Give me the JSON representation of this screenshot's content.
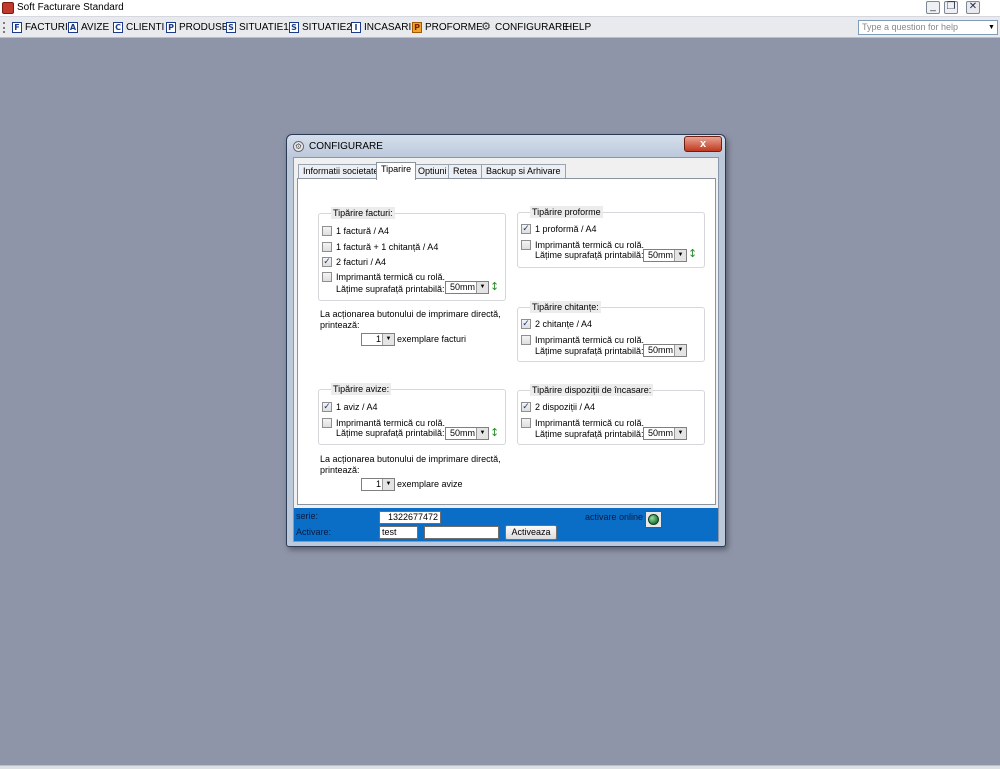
{
  "app": {
    "title": "Soft Facturare Standard"
  },
  "menu": {
    "items": [
      {
        "icon": "F",
        "label": "FACTURI"
      },
      {
        "icon": "A",
        "label": "AVIZE"
      },
      {
        "icon": "C",
        "label": "CLIENTI"
      },
      {
        "icon": "P",
        "label": "PRODUSE"
      },
      {
        "icon": "S",
        "label": "SITUATIE1"
      },
      {
        "icon": "S",
        "label": "SITUATIE2"
      },
      {
        "icon": "I",
        "label": "INCASARI"
      },
      {
        "icon": "P",
        "label": "PROFORME"
      },
      {
        "icon": "⚙",
        "label": "CONFIGURARE"
      },
      {
        "icon": "",
        "label": "HELP"
      }
    ],
    "help_placeholder": "Type a question for help"
  },
  "dialog": {
    "title": "CONFIGURARE",
    "close_label": "x",
    "tabs": [
      "Informatii societate",
      "Tiparire",
      "Optiuni",
      "Retea",
      "Backup si Arhivare"
    ],
    "active_tab": "Tiparire",
    "facturi": {
      "title": "Tipărire facturi:",
      "opt1": "1 factură / A4",
      "opt2": "1 factură + 1 chitanță / A4",
      "opt3": "2 facturi / A4",
      "opt4": "Imprimantă termică cu rolă.",
      "width_label": "Lățime suprafață printabilă:",
      "width_value": "50mm",
      "checked": [
        false,
        false,
        true,
        false
      ]
    },
    "direct_print_facturi": {
      "line1": "La acționarea butonului de imprimare directă,",
      "line2": "printează:",
      "count": "1",
      "suffix": "exemplare facturi"
    },
    "avize": {
      "title": "Tipărire avize:",
      "opt1": "1 aviz / A4",
      "opt2": "Imprimantă termică cu rolă.",
      "width_label": "Lățime suprafață printabilă:",
      "width_value": "50mm",
      "checked": [
        true,
        false
      ]
    },
    "direct_print_avize": {
      "line1": "La acționarea butonului de imprimare directă,",
      "line2": "printează:",
      "count": "1",
      "suffix": "exemplare avize"
    },
    "proforme": {
      "title": "Tipărire proforme",
      "opt1": "1 proformă / A4",
      "opt2": "Imprimantă termică cu rolă.",
      "width_label": "Lățime suprafață printabilă:",
      "width_value": "50mm",
      "checked": [
        true,
        false
      ]
    },
    "chitante": {
      "title": "Tipărire chitanțe:",
      "opt1": "2 chitanțe / A4",
      "opt2": "Imprimantă termică cu rolă.",
      "width_label": "Lățime suprafață printabilă:",
      "width_value": "50mm",
      "checked": [
        true,
        false
      ]
    },
    "dispozitii": {
      "title": "Tipărire dispoziții de încasare:",
      "opt1": "2 dispoziții / A4",
      "opt2": "Imprimantă termică cu rolă.",
      "width_label": "Lățime suprafață printabilă:",
      "width_value": "50mm",
      "checked": [
        true,
        false
      ]
    },
    "activation": {
      "serie_label": "serie:",
      "serie_value": "1322677472",
      "activare_label": "Activare:",
      "activare_value": "test",
      "activare_value2": "",
      "button_label": "Activeaza",
      "online_label": "activare online"
    }
  },
  "colors": {
    "desktop": "#8e95a8",
    "activation_strip": "#0a6ec7",
    "close_button": "#c0391f"
  }
}
